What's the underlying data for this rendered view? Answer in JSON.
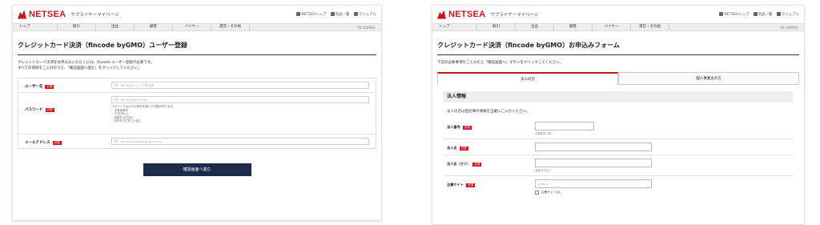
{
  "brand": {
    "name": "NETSEA",
    "subtitle": "サプライヤーマイページ"
  },
  "toplinks": [
    "NETSEAトップ",
    "商品一覧",
    "マニュアル"
  ],
  "nav": [
    "トップ",
    "取引",
    "出品",
    "顧客",
    "バイヤー",
    "運営・その他"
  ],
  "nav_right": "ID:100000",
  "left": {
    "title": "クレジットカード決済（fincode byGMO）ユーザー登録",
    "intro": [
      "クレジットカード決済をお申込みいただくには、fincode ユーザー登録が必要です。",
      "すべての項目をご入力のうえ、「確認画面へ進む」をクリックしてください。"
    ],
    "fields": [
      {
        "label": "ユーザー名",
        "required": "必須",
        "placeholder": "例）NETSEAショップ担当者"
      },
      {
        "label": "パスワード",
        "required": "必須",
        "placeholder": "例）NETSEApas12345",
        "notes": [
          "パスワードは以下の条件を満たす必要があります。",
          "・半角英数字",
          "・12文字以上",
          "・英数を必ず含む",
          "・記号を1文字以上含む"
        ]
      },
      {
        "label": "メールアドレス",
        "required": "必須",
        "placeholder": "例）netsea_test@example.com"
      }
    ],
    "submit": "確認画面へ進む"
  },
  "right": {
    "title": "クレジットカード決済（fincode byGMO）お申込みフォーム",
    "intro": "下記の必要事項をご入力の上「確認画面へ」ボタンをクリックしてください。",
    "tabs": [
      "法人の方",
      "個人事業主の方"
    ],
    "section": "法人情報",
    "section_intro": "法人の方は登記簿の情報を正確にご入力ください。",
    "fields": [
      {
        "label": "法人番号",
        "required": "必須",
        "placeholder": "",
        "note": "半角数字13桁"
      },
      {
        "label": "法人名",
        "required": "必須",
        "placeholder": "",
        "note": ""
      },
      {
        "label": "法人名（カナ）",
        "required": "必須",
        "placeholder": "",
        "note": "全角カタカナ"
      },
      {
        "label": "企業サイト",
        "required": "必須",
        "placeholder": "https://",
        "checkbox": "企業サイトなし"
      }
    ]
  }
}
